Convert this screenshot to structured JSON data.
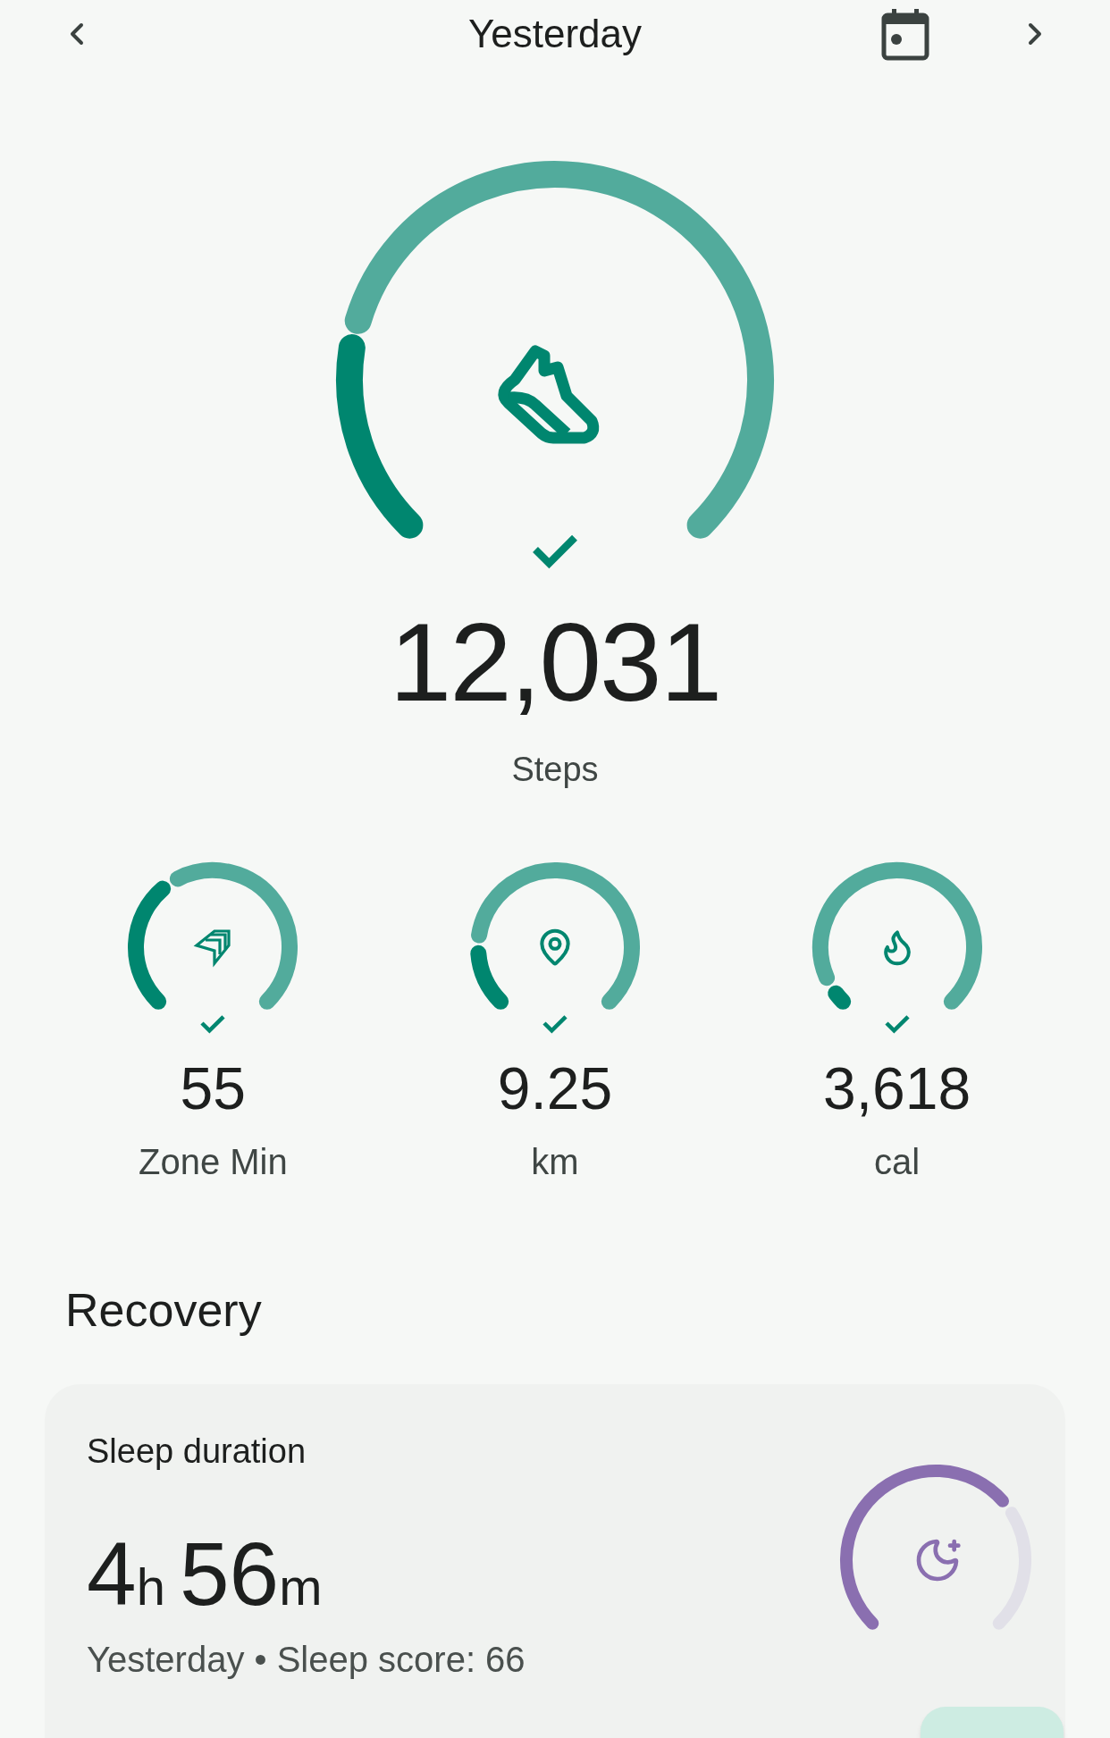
{
  "header": {
    "title": "Yesterday"
  },
  "steps": {
    "value": "12,031",
    "label": "Steps",
    "goal_met": true
  },
  "metrics": [
    {
      "kind": "zone",
      "value": "55",
      "label": "Zone Min",
      "goal_met": true
    },
    {
      "kind": "distance",
      "value": "9.25",
      "label": "km",
      "goal_met": true
    },
    {
      "kind": "calories",
      "value": "3,618",
      "label": "cal",
      "goal_met": true
    }
  ],
  "recovery": {
    "heading": "Recovery",
    "card": {
      "title": "Sleep duration",
      "hours": "4",
      "hours_unit": "h",
      "minutes": "56",
      "minutes_unit": "m",
      "subtitle": "Yesterday • Sleep score: 66"
    }
  }
}
